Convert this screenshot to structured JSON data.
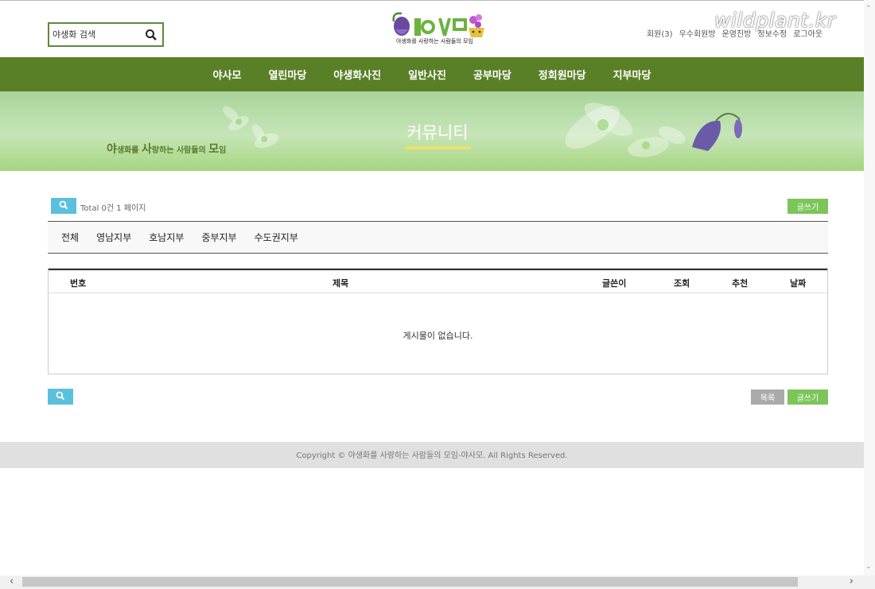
{
  "header": {
    "search_placeholder": "야생화 검색",
    "logo_text": "야사모",
    "logo_subtitle": "야생화를 사랑하는 사람들의 모임",
    "watermark": "wildplant.kr",
    "util_links": [
      "회원(3)",
      "우수회원방",
      "운영진방",
      "정보수정",
      "로그아웃"
    ]
  },
  "nav": [
    "야사모",
    "열린마당",
    "야생화사진",
    "일반사진",
    "공부마당",
    "정회원마당",
    "지부마당"
  ],
  "banner": {
    "title": "커뮤니티",
    "slogan": {
      "part1": "야",
      "part2": "생화를 ",
      "part3": "사",
      "part4": "랑하는 사람들의 ",
      "part5": "모",
      "part6": "임"
    }
  },
  "board": {
    "total_text": "Total 0건 1 페이지",
    "write_label": "글쓰기",
    "list_label": "목록",
    "categories": [
      "전체",
      "영남지부",
      "호남지부",
      "중부지부",
      "수도권지부"
    ],
    "columns": [
      "번호",
      "제목",
      "글쓴이",
      "조회",
      "추천",
      "날짜"
    ],
    "empty_message": "게시물이 없습니다."
  },
  "footer": {
    "copyright": "Copyright © 야생화를 사랑하는 사람들의 모임-야사모. All Rights Reserved."
  },
  "colors": {
    "nav_green": "#5a8027",
    "button_green": "#7cc55a",
    "search_blue": "#5bc0de",
    "accent_yellow": "#e9e36a"
  }
}
